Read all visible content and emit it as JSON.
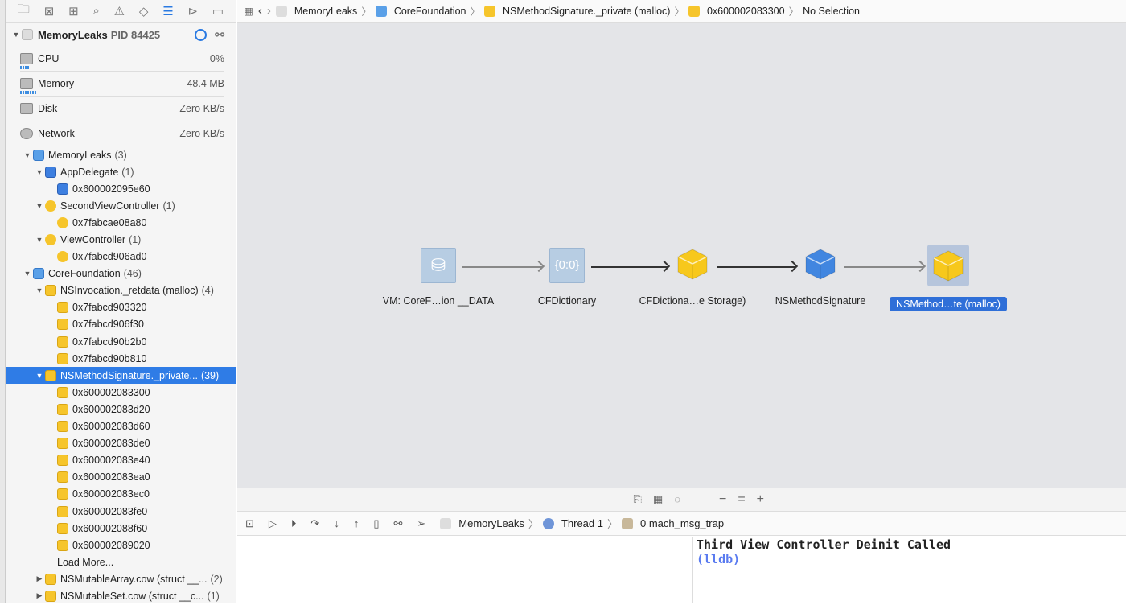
{
  "navigator": {
    "icons": [
      "folder-icon",
      "source-control-icon",
      "hierarchy-icon",
      "search-icon",
      "warning-icon",
      "test-icon",
      "debug-icon",
      "breakpoint-icon",
      "report-icon"
    ],
    "active": "debug-icon"
  },
  "process": {
    "name": "MemoryLeaks",
    "pid": "PID 84425"
  },
  "metrics": [
    {
      "name": "CPU",
      "value": "0%"
    },
    {
      "name": "Memory",
      "value": "48.4 MB"
    },
    {
      "name": "Disk",
      "value": "Zero KB/s"
    },
    {
      "name": "Network",
      "value": "Zero KB/s"
    }
  ],
  "tree": [
    {
      "l": 0,
      "d": "open",
      "i": "p",
      "label": "MemoryLeaks",
      "count": "(3)"
    },
    {
      "l": 1,
      "d": "open",
      "i": "b",
      "label": "AppDelegate",
      "count": "(1)"
    },
    {
      "l": 2,
      "d": "",
      "i": "b",
      "label": "0x600002095e60",
      "count": ""
    },
    {
      "l": 1,
      "d": "open",
      "i": "yc",
      "label": "SecondViewController",
      "count": "(1)"
    },
    {
      "l": 2,
      "d": "",
      "i": "yc",
      "label": "0x7fabcae08a80",
      "count": ""
    },
    {
      "l": 1,
      "d": "open",
      "i": "yc",
      "label": "ViewController",
      "count": "(1)"
    },
    {
      "l": 2,
      "d": "",
      "i": "yc",
      "label": "0x7fabcd906ad0",
      "count": ""
    },
    {
      "l": 0,
      "d": "open",
      "i": "p",
      "label": "CoreFoundation",
      "count": "(46)"
    },
    {
      "l": 1,
      "d": "open",
      "i": "y",
      "label": "NSInvocation._retdata (malloc)",
      "count": "(4)"
    },
    {
      "l": 2,
      "d": "",
      "i": "y",
      "label": "0x7fabcd903320",
      "count": ""
    },
    {
      "l": 2,
      "d": "",
      "i": "y",
      "label": "0x7fabcd906f30",
      "count": ""
    },
    {
      "l": 2,
      "d": "",
      "i": "y",
      "label": "0x7fabcd90b2b0",
      "count": ""
    },
    {
      "l": 2,
      "d": "",
      "i": "y",
      "label": "0x7fabcd90b810",
      "count": ""
    },
    {
      "l": 1,
      "d": "open",
      "i": "y",
      "label": "NSMethodSignature._private...",
      "count": "(39)",
      "sel": true
    },
    {
      "l": 2,
      "d": "",
      "i": "y",
      "label": "0x600002083300",
      "count": ""
    },
    {
      "l": 2,
      "d": "",
      "i": "y",
      "label": "0x600002083d20",
      "count": ""
    },
    {
      "l": 2,
      "d": "",
      "i": "y",
      "label": "0x600002083d60",
      "count": ""
    },
    {
      "l": 2,
      "d": "",
      "i": "y",
      "label": "0x600002083de0",
      "count": ""
    },
    {
      "l": 2,
      "d": "",
      "i": "y",
      "label": "0x600002083e40",
      "count": ""
    },
    {
      "l": 2,
      "d": "",
      "i": "y",
      "label": "0x600002083ea0",
      "count": ""
    },
    {
      "l": 2,
      "d": "",
      "i": "y",
      "label": "0x600002083ec0",
      "count": ""
    },
    {
      "l": 2,
      "d": "",
      "i": "y",
      "label": "0x600002083fe0",
      "count": ""
    },
    {
      "l": 2,
      "d": "",
      "i": "y",
      "label": "0x600002088f60",
      "count": ""
    },
    {
      "l": 2,
      "d": "",
      "i": "y",
      "label": "0x600002089020",
      "count": ""
    },
    {
      "l": 2,
      "d": "",
      "i": "",
      "label": "Load More...",
      "count": ""
    },
    {
      "l": 1,
      "d": "closed",
      "i": "y",
      "label": "NSMutableArray.cow (struct __...",
      "count": "(2)"
    },
    {
      "l": 1,
      "d": "closed",
      "i": "y",
      "label": "NSMutableSet.cow (struct __c...",
      "count": "(1)"
    }
  ],
  "breadcrumb": [
    "MemoryLeaks",
    "CoreFoundation",
    "NSMethodSignature._private (malloc)",
    "0x600002083300",
    "No Selection"
  ],
  "graph": {
    "nodes": [
      {
        "label": "VM: CoreF…ion __DATA",
        "kind": "vm-region"
      },
      {
        "label": "CFDictionary",
        "kind": "dictionary"
      },
      {
        "label": "CFDictiona…e Storage)",
        "kind": "yellow-cube"
      },
      {
        "label": "NSMethodSignature",
        "kind": "blue-cube"
      },
      {
        "label": "NSMethod…te (malloc)",
        "kind": "yellow-cube",
        "selected": true
      }
    ],
    "dict_glyph": "{0:0}"
  },
  "zoom_controls": [
    "−",
    "=",
    "+"
  ],
  "debug": {
    "crumbs": [
      "MemoryLeaks",
      "Thread 1",
      "0 mach_msg_trap"
    ]
  },
  "console": {
    "lines": [
      "Third View Controller Deinit Called"
    ],
    "prompt": "(lldb)"
  }
}
